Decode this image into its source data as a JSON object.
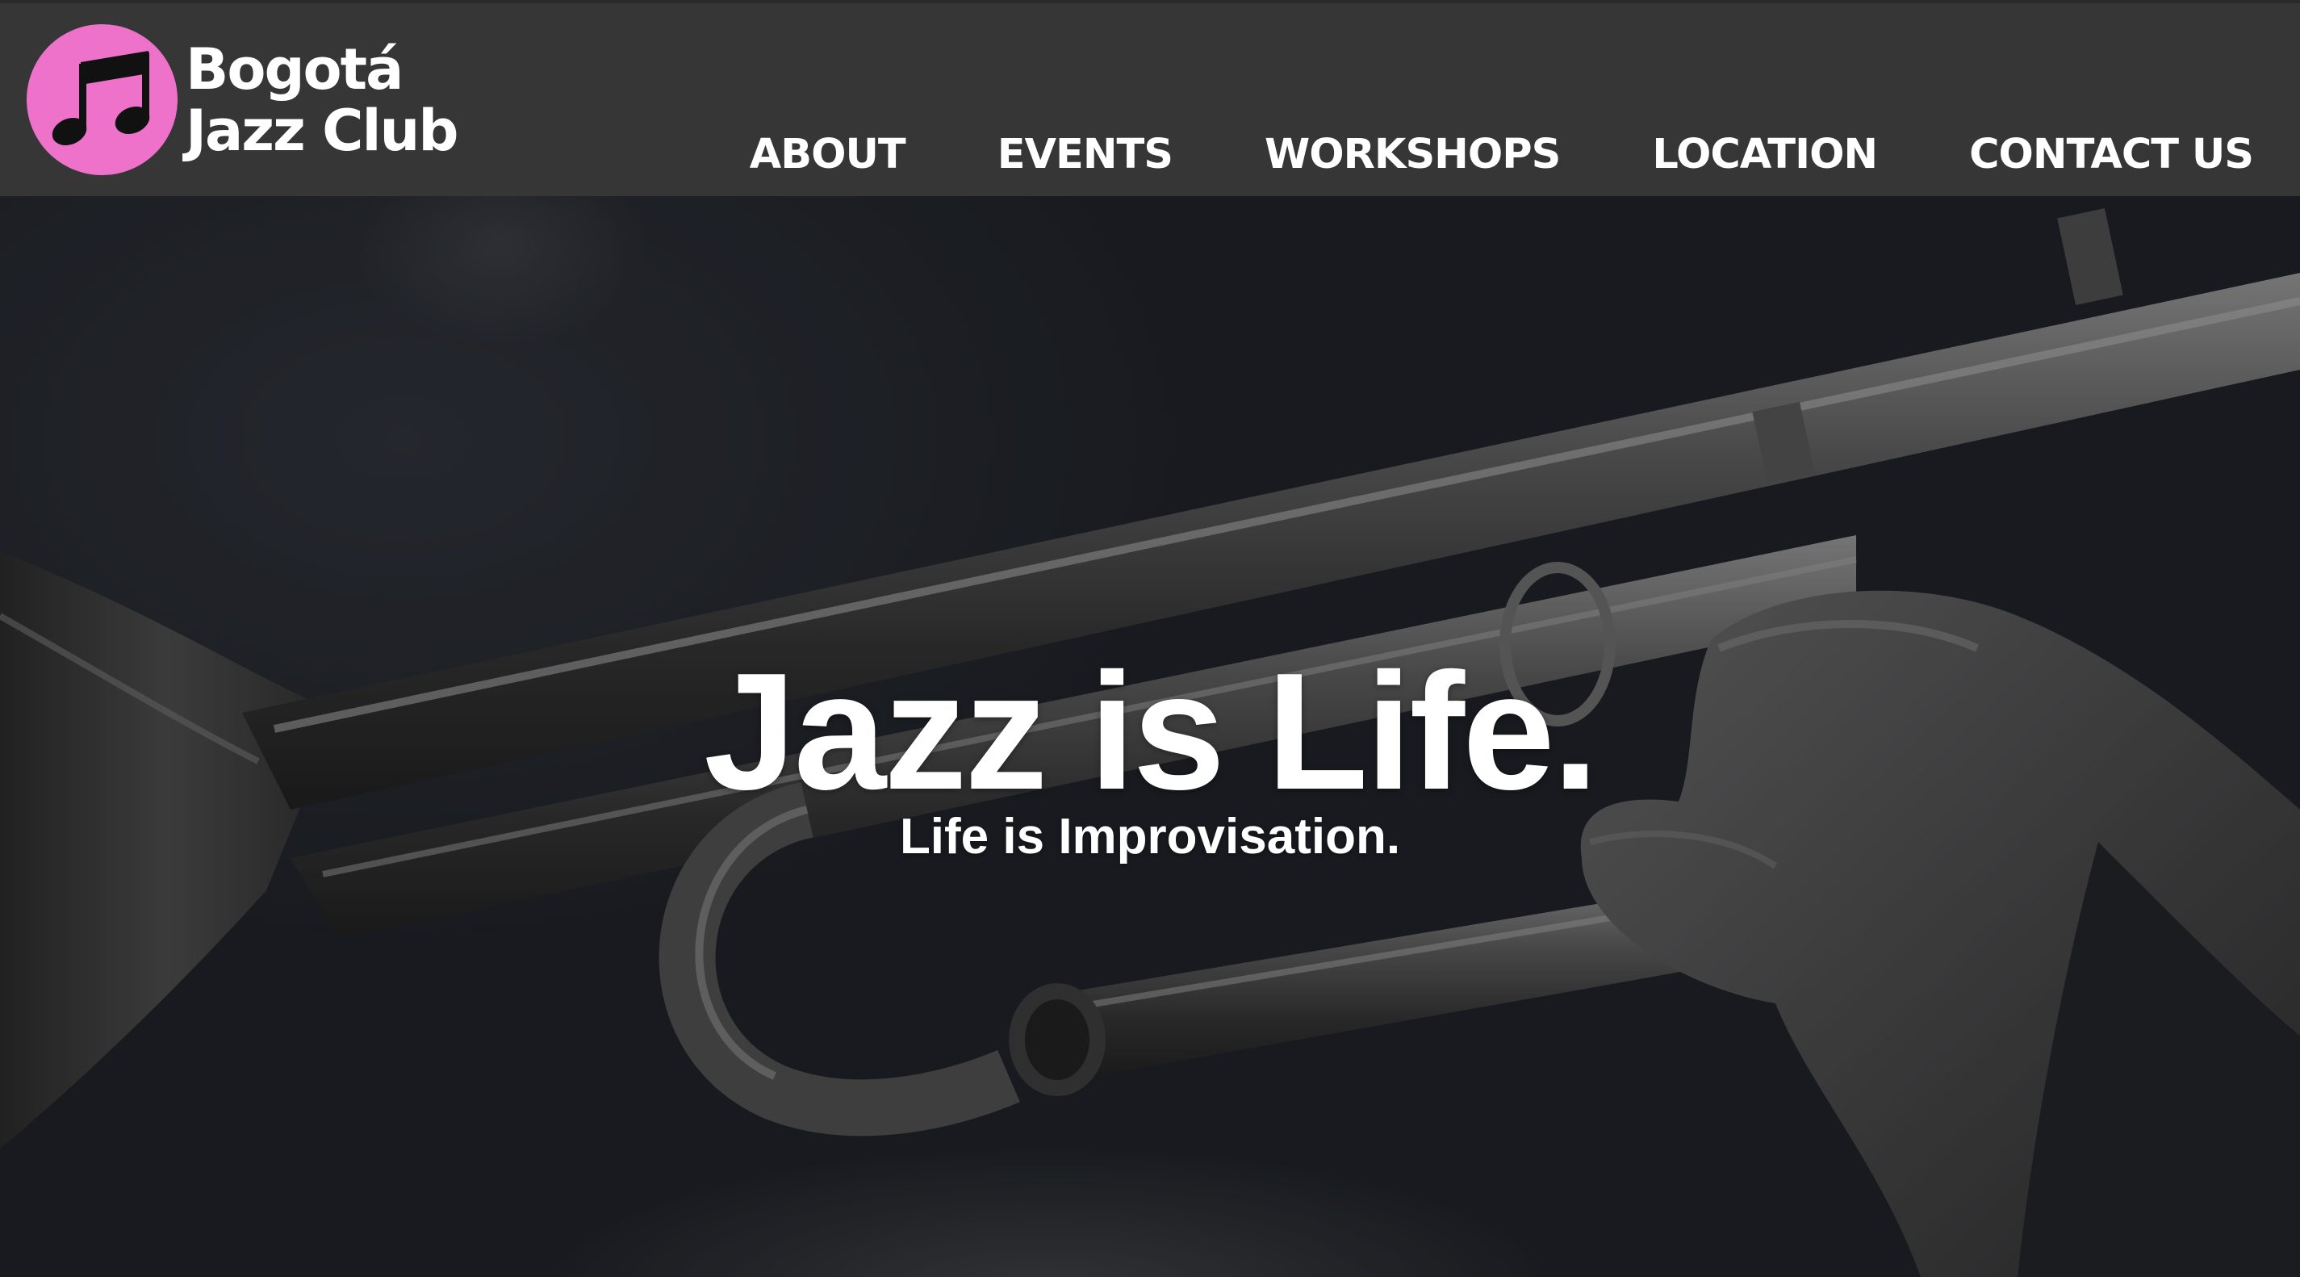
{
  "site": {
    "brand_line1": "Bogotá",
    "brand_line2": "Jazz Club",
    "logo_icon": "music-note-icon",
    "logo_color": "#ee72c9",
    "header_bg": "#363636"
  },
  "nav": {
    "items": [
      {
        "label": "ABOUT"
      },
      {
        "label": "EVENTS"
      },
      {
        "label": "WORKSHOPS"
      },
      {
        "label": "LOCATION"
      },
      {
        "label": "CONTACT US"
      }
    ]
  },
  "hero": {
    "title": "Jazz is Life.",
    "subtitle": "Life is Improvisation.",
    "background_image": "trumpet-player-photo"
  }
}
